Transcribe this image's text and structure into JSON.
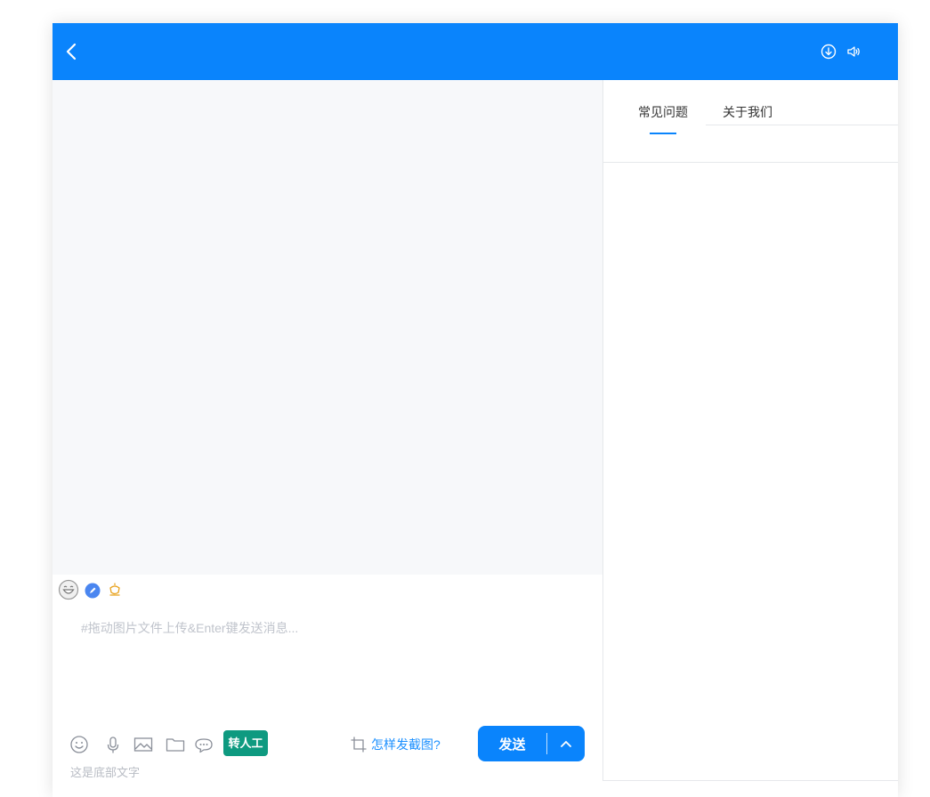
{
  "header": {
    "back_icon": "chevron-left-icon",
    "download_icon": "download-circle-icon",
    "sound_icon": "speaker-icon",
    "background": "#0a84fc"
  },
  "emoji_bar": {
    "items": [
      "laughing-face-icon",
      "blue-pencil-badge-icon",
      "orange-flower-icon"
    ]
  },
  "composer": {
    "placeholder": "#拖动图片文件上传&Enter键发送消息...",
    "value": ""
  },
  "toolbar": {
    "icons": [
      "smiley-icon",
      "microphone-icon",
      "image-icon",
      "folder-icon",
      "chat-bubble-icon"
    ],
    "transfer_label": "转人工",
    "transfer_color": "#0e9a80",
    "screenshot_label": "怎样发截图?",
    "send_label": "发送"
  },
  "footer": {
    "text": "这是底部文字"
  },
  "side_panel": {
    "tabs": [
      {
        "label": "常见问题",
        "active": true
      },
      {
        "label": "关于我们",
        "active": false
      }
    ]
  }
}
